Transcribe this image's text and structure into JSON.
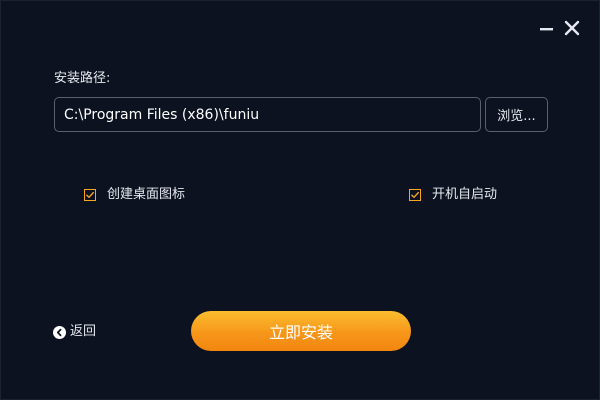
{
  "window": {
    "minimize_icon": "minimize-icon",
    "close_icon": "close-icon"
  },
  "install_path": {
    "label": "安装路径:",
    "value": "C:\\Program Files (x86)\\funiu",
    "browse_label": "浏览..."
  },
  "options": {
    "desktop_icon": {
      "label": "创建桌面图标",
      "checked": true
    },
    "auto_start": {
      "label": "开机自启动",
      "checked": true
    }
  },
  "footer": {
    "back_label": "返回",
    "back_icon": "back-arrow-icon",
    "install_label": "立即安装"
  },
  "colors": {
    "background": "#0c121f",
    "accent": "#f5a623",
    "install_gradient_top": "#fbbd2e",
    "install_gradient_bottom": "#f28610"
  }
}
